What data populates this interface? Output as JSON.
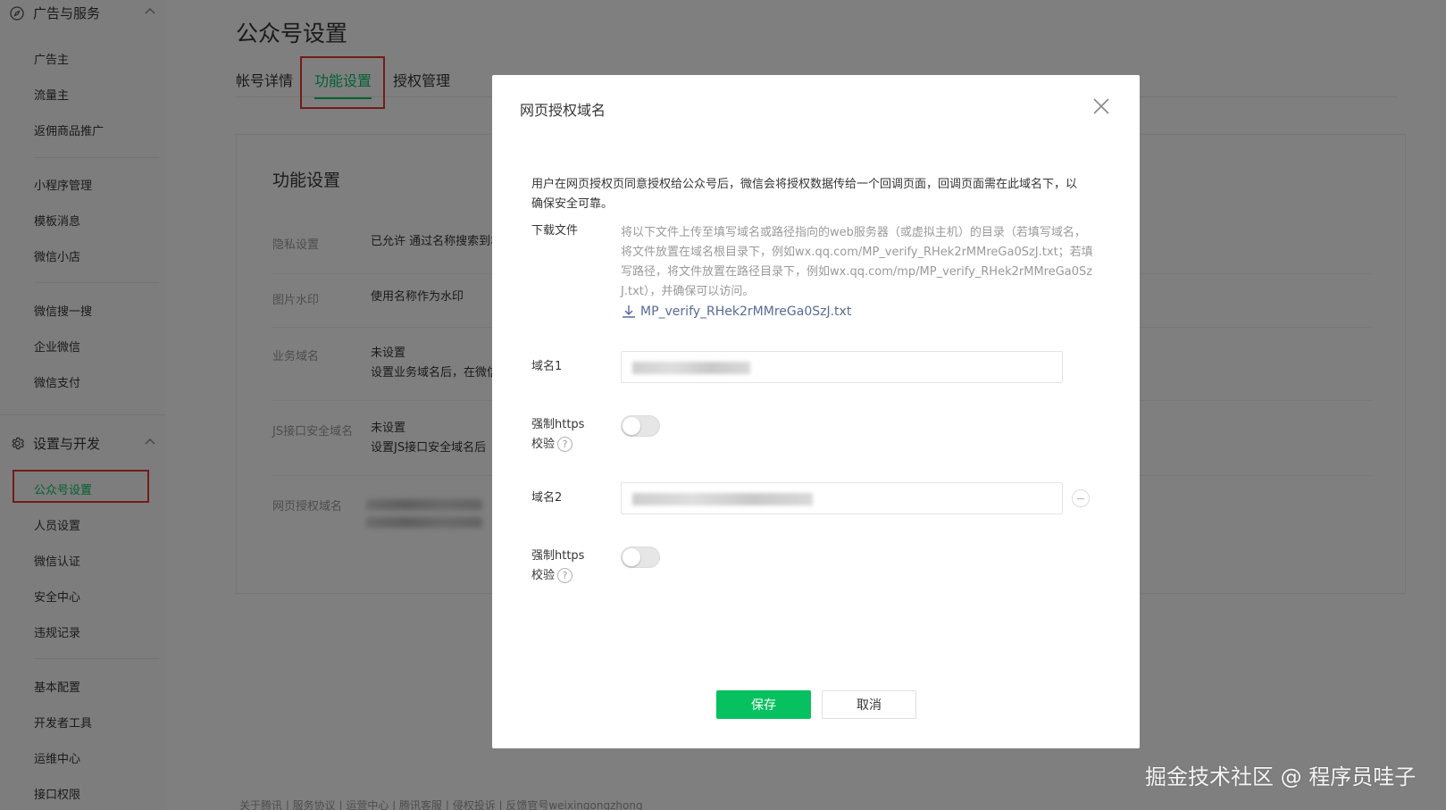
{
  "sidebar": {
    "group1": {
      "label": "广告与服务",
      "icon": "compass-icon"
    },
    "items_ad": [
      "广告主",
      "流量主",
      "返佣商品推广"
    ],
    "items_mid": [
      "小程序管理",
      "模板消息",
      "微信小店"
    ],
    "items_more": [
      "微信搜一搜",
      "企业微信",
      "微信支付"
    ],
    "group2": {
      "label": "设置与开发",
      "icon": "gear-icon"
    },
    "items_settings": [
      "公众号设置",
      "人员设置",
      "微信认证",
      "安全中心",
      "违规记录"
    ],
    "items_dev": [
      "基本配置",
      "开发者工具",
      "运维中心",
      "接口权限"
    ]
  },
  "main": {
    "title": "公众号设置",
    "tabs": [
      "帐号详情",
      "功能设置",
      "授权管理"
    ],
    "card_title": "功能设置",
    "rows": [
      {
        "label": "隐私设置",
        "value": "已允许 通过名称搜索到本"
      },
      {
        "label": "图片水印",
        "value": "使用名称作为水印"
      },
      {
        "label": "业务域名",
        "value": "未设置",
        "sub": "设置业务域名后，在微信"
      },
      {
        "label": "JS接口安全域名",
        "value": "未设置",
        "sub": "设置JS接口安全域名后"
      },
      {
        "label": "网页授权域名",
        "value": ""
      }
    ],
    "footer": "关于腾讯  |  服务协议  |  运营中心  |  腾讯客服  |  侵权投诉  |  反馈官号weixingongzhong"
  },
  "dialog": {
    "title": "网页授权域名",
    "intro": "用户在网页授权页同意授权给公众号后，微信会将授权数据传给一个回调页面，回调页面需在此域名下，以确保安全可靠。",
    "download_label": "下载文件",
    "download_desc": "将以下文件上传至填写域名或路径指向的web服务器（或虚拟主机）的目录（若填写域名，将文件放置在域名根目录下，例如wx.qq.com/MP_verify_RHek2rMMreGa0SzJ.txt；若填写路径，将文件放置在路径目录下，例如wx.qq.com/mp/MP_verify_RHek2rMMreGa0SzJ.txt），并确保可以访问。",
    "download_file": "MP_verify_RHek2rMMreGa0SzJ.txt",
    "domain1_label": "域名1",
    "domain2_label": "域名2",
    "https_label_1": "强制https",
    "https_label_2": "校验",
    "help_glyph": "?",
    "save_label": "保存",
    "cancel_label": "取消"
  },
  "watermark": "掘金技术社区 @ 程序员哇子",
  "colors": {
    "accent": "#07c160",
    "link": "#576b95",
    "highlight": "#e53935"
  }
}
